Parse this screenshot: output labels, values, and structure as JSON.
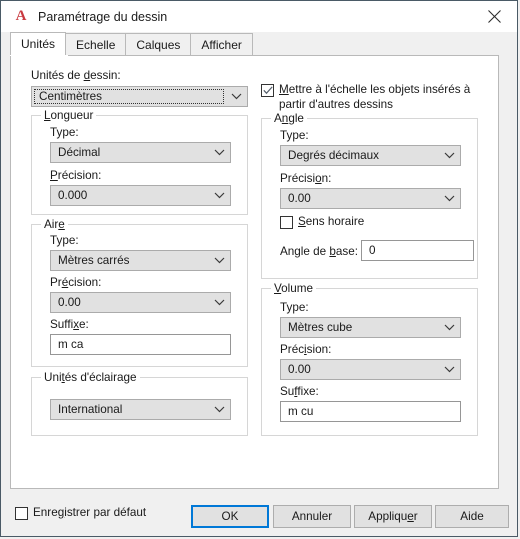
{
  "window": {
    "title": "Paramétrage du dessin",
    "app_icon": "autocad-a-icon",
    "close_icon": "close-icon",
    "accent_color": "#0078d7",
    "logo_color": "#c9393f"
  },
  "tabs": [
    {
      "label": "Unités",
      "active": true
    },
    {
      "label": "Echelle",
      "active": false
    },
    {
      "label": "Calques",
      "active": false
    },
    {
      "label": "Afficher",
      "active": false
    }
  ],
  "units": {
    "drawing_units_label_pre": "Unités de ",
    "drawing_units_label_accel": "d",
    "drawing_units_label_post": "essin:",
    "drawing_units_value": "Centimètres"
  },
  "length": {
    "group_title_pre": "",
    "group_title_accel": "L",
    "group_title_post": "ongueur",
    "type_label": "Type:",
    "type_value": "Décimal",
    "precision_label_pre": "",
    "precision_label_accel": "P",
    "precision_label_post": "récision:",
    "precision_value": "0.000"
  },
  "area": {
    "group_title_pre": "Air",
    "group_title_accel": "e",
    "group_title_post": "",
    "type_label": "Type:",
    "type_value": "Mètres carrés",
    "precision_label_pre": "Pr",
    "precision_label_accel": "é",
    "precision_label_post": "cision:",
    "precision_value": "0.00",
    "suffix_label_pre": "Suffi",
    "suffix_label_accel": "x",
    "suffix_label_post": "e:",
    "suffix_value": "m ca"
  },
  "lighting": {
    "group_title_pre": "Uni",
    "group_title_accel": "t",
    "group_title_post": "és d'éclairage",
    "value": "International"
  },
  "scale_objects": {
    "label_accel": "M",
    "label_rest": "ettre à l'échelle les objets insérés à partir d'autres dessins",
    "checked": true
  },
  "angle": {
    "group_title_pre": "A",
    "group_title_accel": "n",
    "group_title_post": "gle",
    "type_label": "Type:",
    "type_value": "Degrés décimaux",
    "precision_label_pre": "Précisi",
    "precision_label_accel": "o",
    "precision_label_post": "n:",
    "precision_value": "0.00",
    "clockwise_label_pre": "",
    "clockwise_label_accel": "S",
    "clockwise_label_post": "ens horaire",
    "clockwise_checked": false,
    "base_angle_label_pre": "Angle de ",
    "base_angle_label_accel": "b",
    "base_angle_label_post": "ase:",
    "base_angle_value": "0"
  },
  "volume": {
    "group_title_pre": "",
    "group_title_accel": "V",
    "group_title_post": "olume",
    "type_label": "Type:",
    "type_value": "Mètres cube",
    "precision_label_pre": "Préc",
    "precision_label_accel": "i",
    "precision_label_post": "sion:",
    "precision_value": "0.00",
    "suffix_label_pre": "Su",
    "suffix_label_accel": "f",
    "suffix_label_post": "fixe:",
    "suffix_value": "m cu"
  },
  "footer": {
    "save_default_label_pre": "Enre",
    "save_default_label_accel": "g",
    "save_default_label_post": "istrer par défaut",
    "save_default_checked": false,
    "buttons": [
      {
        "label": "OK",
        "default": true
      },
      {
        "label": "Annuler",
        "default": false
      },
      {
        "label": "Appliquer",
        "default": false
      },
      {
        "label": "Aide",
        "default": false
      }
    ]
  }
}
